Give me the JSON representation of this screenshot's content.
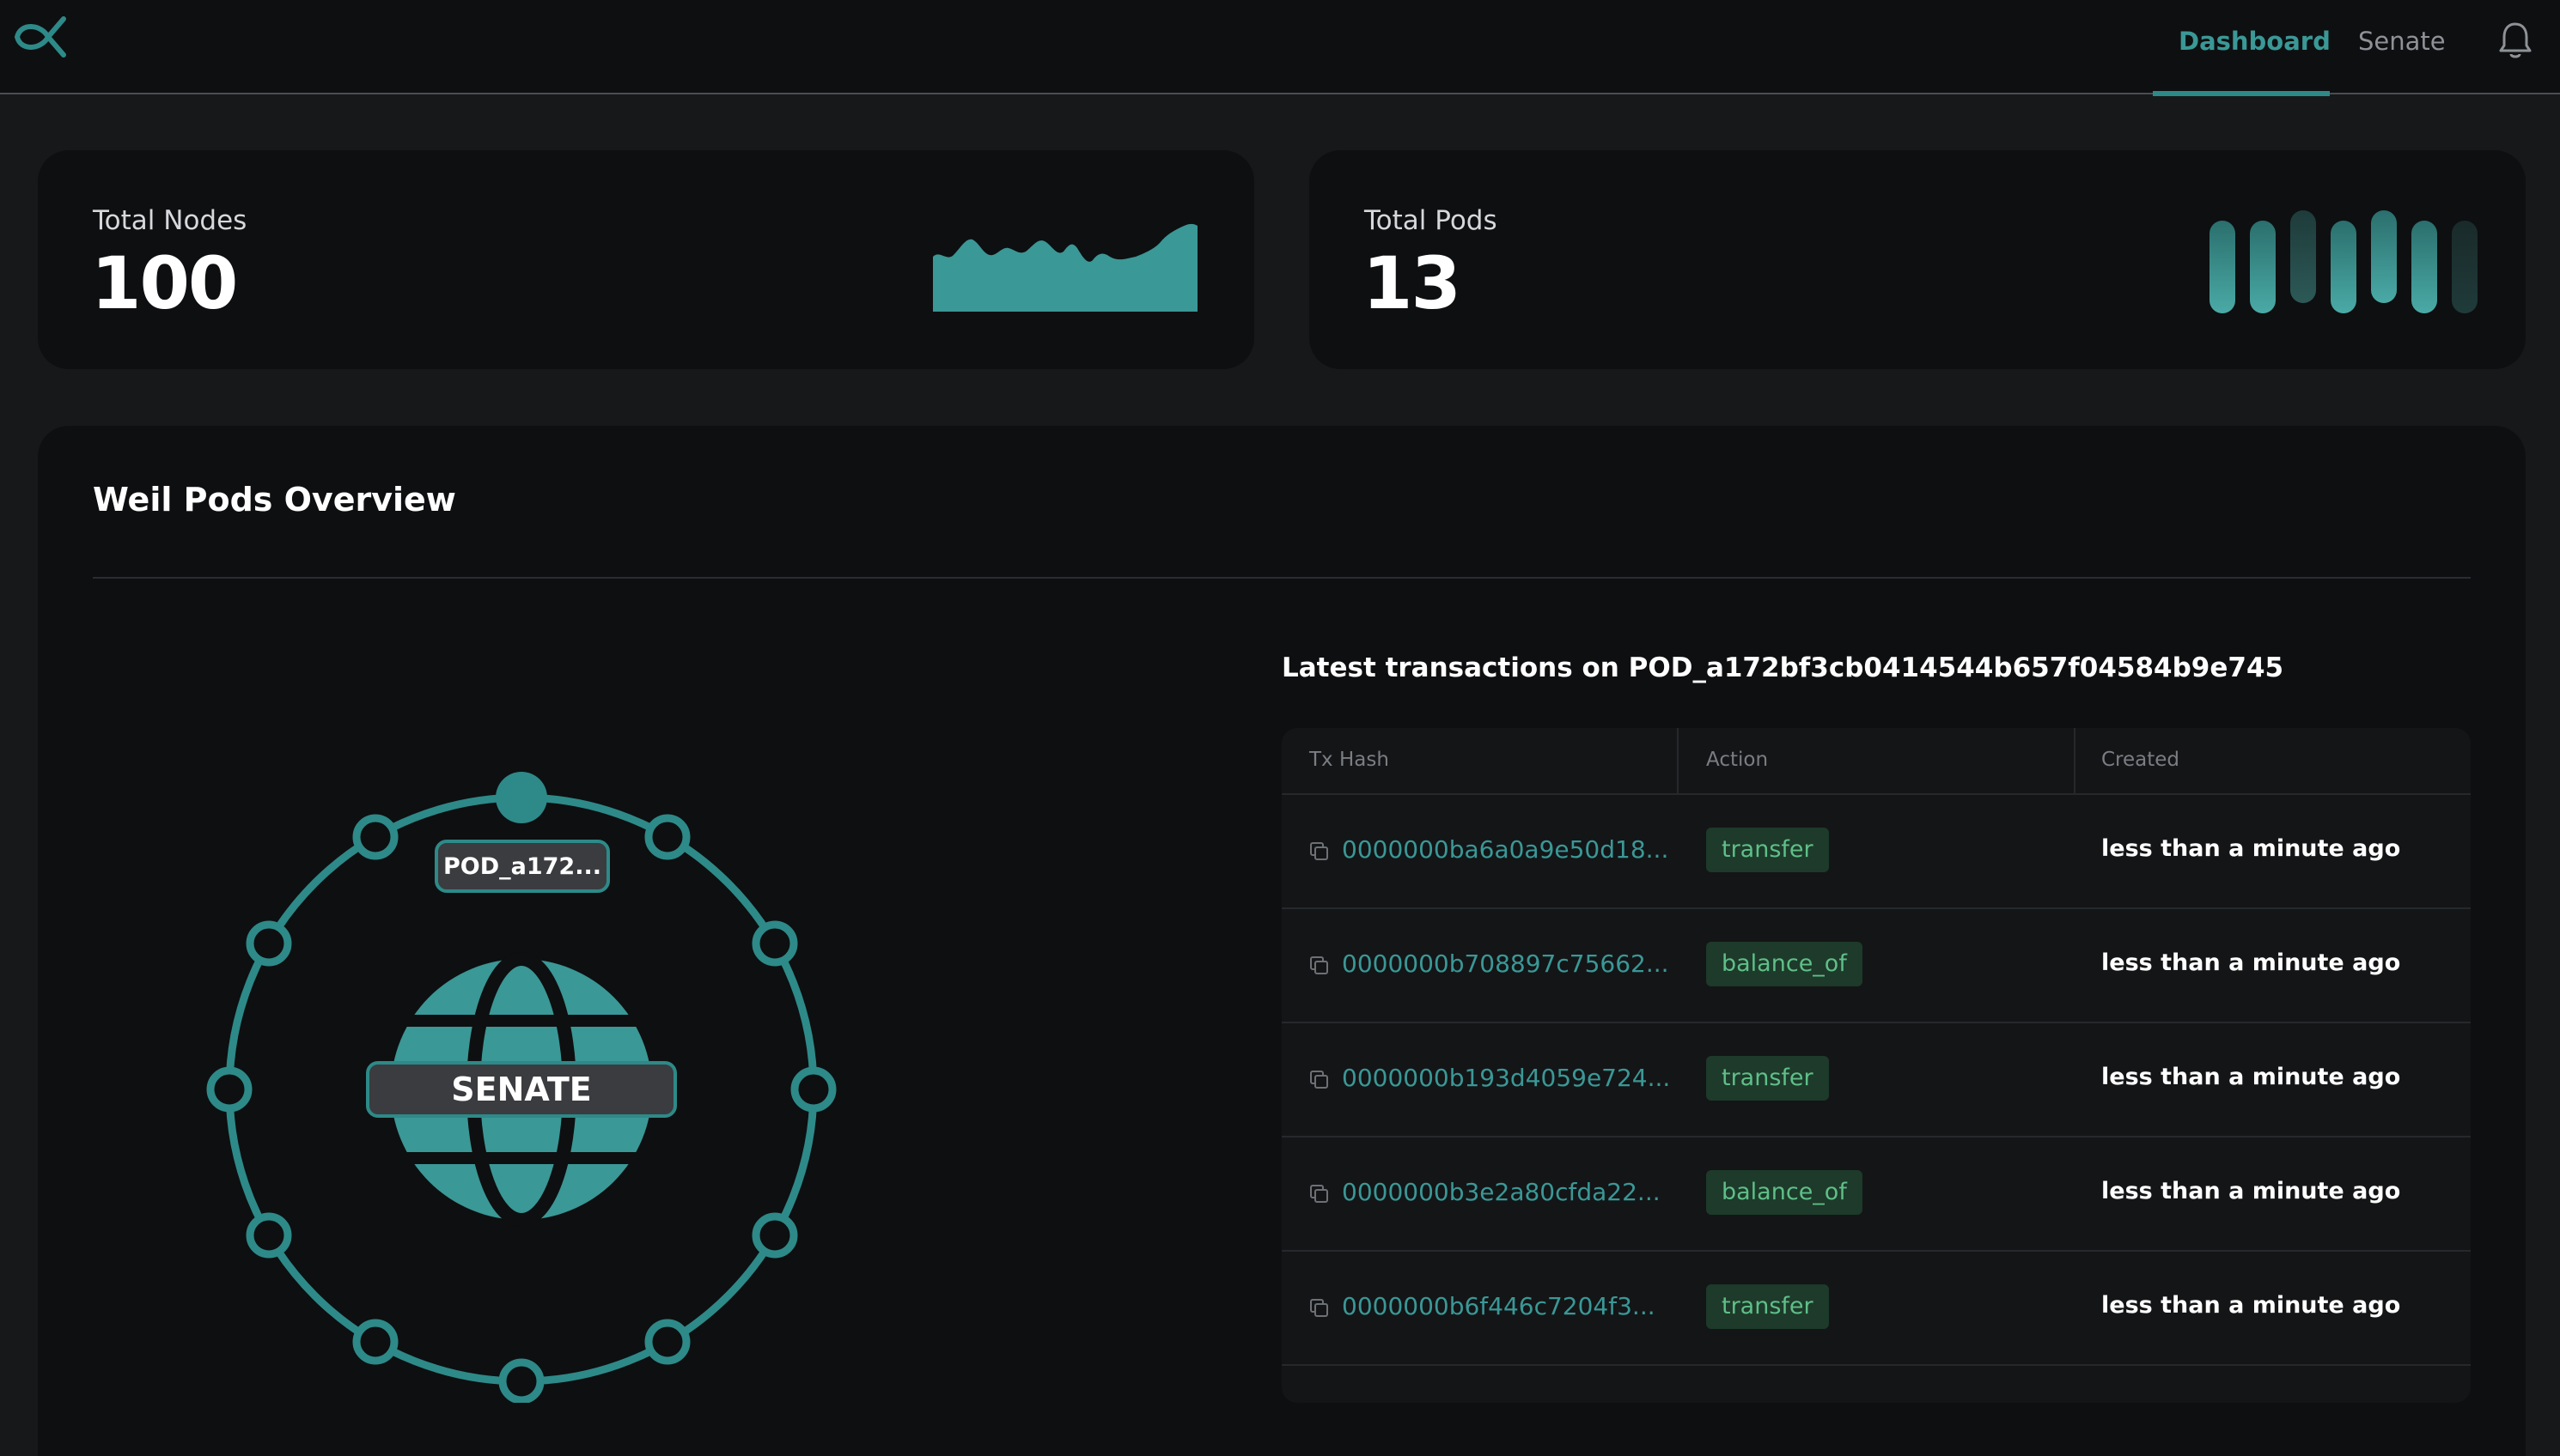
{
  "header": {
    "tabs": [
      {
        "label": "Dashboard",
        "active": true
      },
      {
        "label": "Senate",
        "active": false
      }
    ],
    "logo_icon": "alpha-logo-icon",
    "notification_icon": "bell-icon"
  },
  "stats": {
    "nodes": {
      "label": "Total Nodes",
      "value": "100"
    },
    "pods": {
      "label": "Total Pods",
      "value": "13"
    }
  },
  "overview": {
    "title": "Weil Pods Overview",
    "diagram": {
      "center_label": "SENATE",
      "pod_label": "POD_a172..."
    }
  },
  "transactions": {
    "heading": "Latest transactions on POD_a172bf3cb0414544b657f04584b9e745",
    "columns": [
      "Tx Hash",
      "Action",
      "Created"
    ],
    "rows": [
      {
        "hash": "0000000ba6a0a9e50d18...",
        "action": "transfer",
        "created": "less than a minute ago"
      },
      {
        "hash": "0000000b708897c75662...",
        "action": "balance_of",
        "created": "less than a minute ago"
      },
      {
        "hash": "0000000b193d4059e724...",
        "action": "transfer",
        "created": "less than a minute ago"
      },
      {
        "hash": "0000000b3e2a80cfda22...",
        "action": "balance_of",
        "created": "less than a minute ago"
      },
      {
        "hash": "0000000b6f446c7204f3...",
        "action": "transfer",
        "created": "less than a minute ago"
      }
    ]
  },
  "colors": {
    "accent": "#2d8a88",
    "background": "#17181a",
    "card": "#0e0f11",
    "badge_bg": "#1d3a2a",
    "badge_text": "#5fbf88"
  }
}
